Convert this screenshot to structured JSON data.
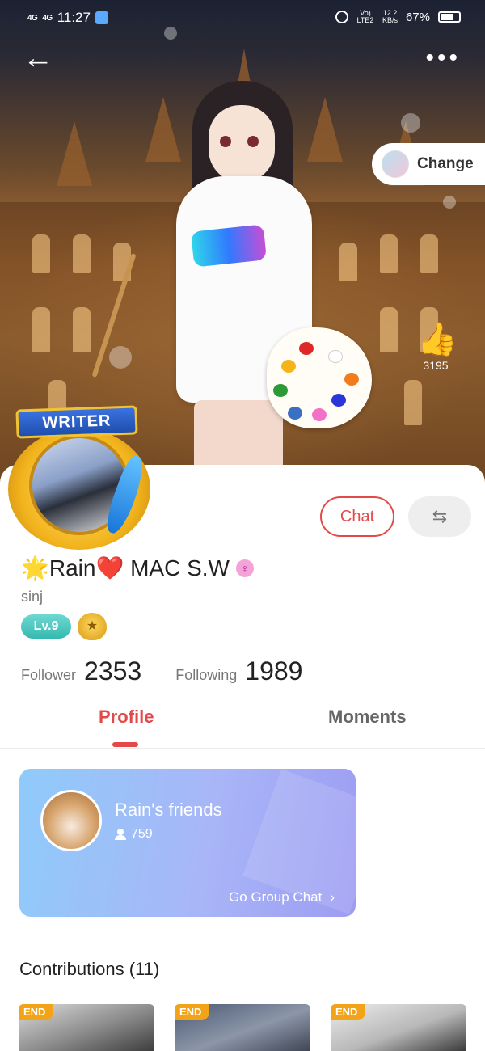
{
  "status_bar": {
    "network_1": "4G",
    "network_2": "4G",
    "time": "11:27",
    "volte": "Vo) LTE2",
    "speed_value": "12.2",
    "speed_unit": "KB/s",
    "battery": "67%"
  },
  "hero": {
    "change_label": "Change",
    "like_count": "3195"
  },
  "profile": {
    "badge_text": "WRITER",
    "name": "🌟Rain❤️ MAC S.W",
    "handle": "sinj",
    "level": "Lv.9",
    "chat_label": "Chat",
    "follower_label": "Follower",
    "follower_count": "2353",
    "following_label": "Following",
    "following_count": "1989"
  },
  "tabs": [
    {
      "label": "Profile",
      "active": true
    },
    {
      "label": "Moments",
      "active": false
    }
  ],
  "group": {
    "title": "Rain's friends",
    "member_count": "759",
    "action": "Go Group Chat"
  },
  "contributions": {
    "title": "Contributions (11)",
    "items": [
      {
        "badge": "END"
      },
      {
        "badge": "END"
      },
      {
        "badge": "END"
      }
    ]
  },
  "colors": {
    "accent": "#e24a4a",
    "level": "#35b9b0",
    "end_badge": "#f2a318"
  }
}
